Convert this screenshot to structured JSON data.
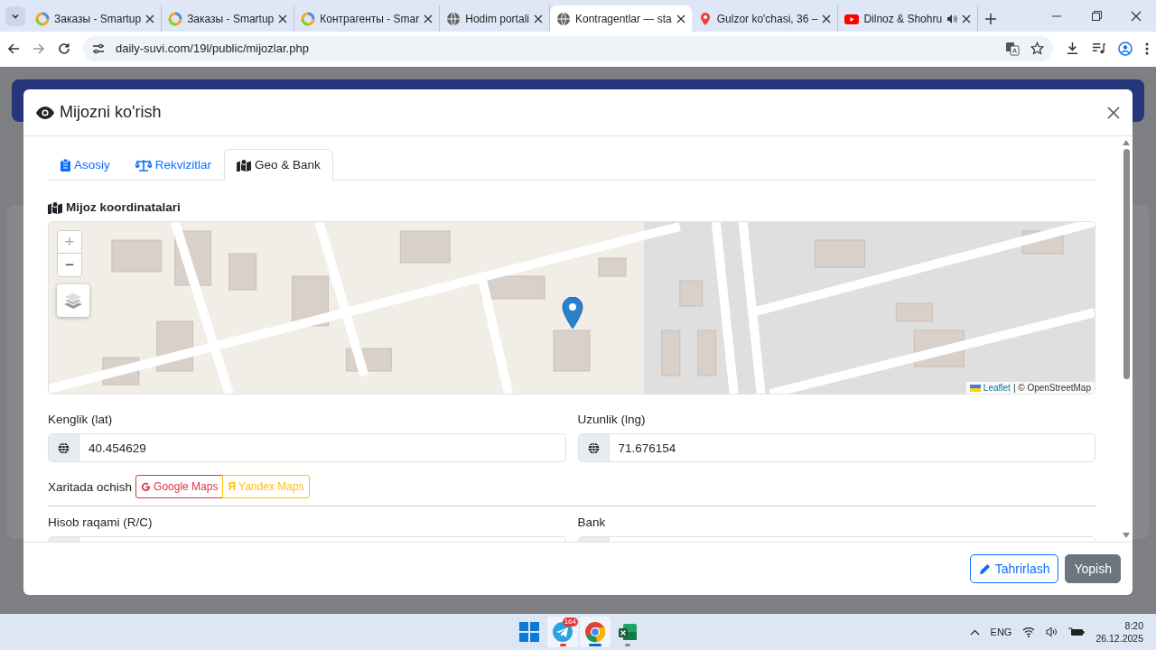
{
  "browser": {
    "tabs": [
      {
        "title": "Заказы - Smartup",
        "kind": "smartup",
        "audio": false,
        "selected": false
      },
      {
        "title": "Заказы - Smartup",
        "kind": "smartup",
        "audio": false,
        "selected": false
      },
      {
        "title": "Контрагенты - Smar",
        "kind": "smartup",
        "audio": false,
        "selected": false
      },
      {
        "title": "Hodim portali",
        "kind": "globe",
        "audio": false,
        "selected": false
      },
      {
        "title": "Kontragentlar — sta",
        "kind": "globe",
        "audio": false,
        "selected": true
      },
      {
        "title": "Gulzor ko'chasi, 36 –",
        "kind": "pin",
        "audio": false,
        "selected": false
      },
      {
        "title": "Dilnoz & Shohru",
        "kind": "youtube",
        "audio": true,
        "selected": false
      }
    ],
    "url": "daily-suvi.com/19l/public/mijozlar.php"
  },
  "modal": {
    "title": "Mijozni ko'rish",
    "tabs": [
      {
        "label": "Asosiy",
        "selected": false
      },
      {
        "label": "Rekvizitlar",
        "selected": false
      },
      {
        "label": "Geo & Bank",
        "selected": true
      }
    ],
    "section_title": "Mijoz koordinatalari",
    "map": {
      "zoom_in": "+",
      "zoom_out": "−",
      "attribution_link": "Leaflet",
      "attribution_text": "| © OpenStreetMap"
    },
    "fields": [
      {
        "label": "Kenglik (lat)",
        "value": "40.454629"
      },
      {
        "label": "Uzunlik (lng)",
        "value": "71.676154"
      }
    ],
    "open_in_map": {
      "label": "Xaritada ochish",
      "links": [
        {
          "kind": "google",
          "label": "Google Maps"
        },
        {
          "kind": "yandex",
          "icon_text": "Я",
          "label": "Yandex Maps"
        }
      ]
    },
    "bank_fields": [
      {
        "label": "Hisob raqami (R/C)"
      },
      {
        "label": "Bank"
      }
    ],
    "buttons": [
      {
        "kind": "edit",
        "label": "Tahrirlash"
      },
      {
        "kind": "close",
        "label": "Yopish"
      }
    ]
  },
  "taskbar": {
    "apps": [
      {
        "kind": "start"
      },
      {
        "kind": "telegram",
        "badge": "164"
      },
      {
        "kind": "chrome"
      },
      {
        "kind": "excel"
      }
    ],
    "language": "ENG",
    "time": "8:20",
    "date": "26.12.2025"
  }
}
